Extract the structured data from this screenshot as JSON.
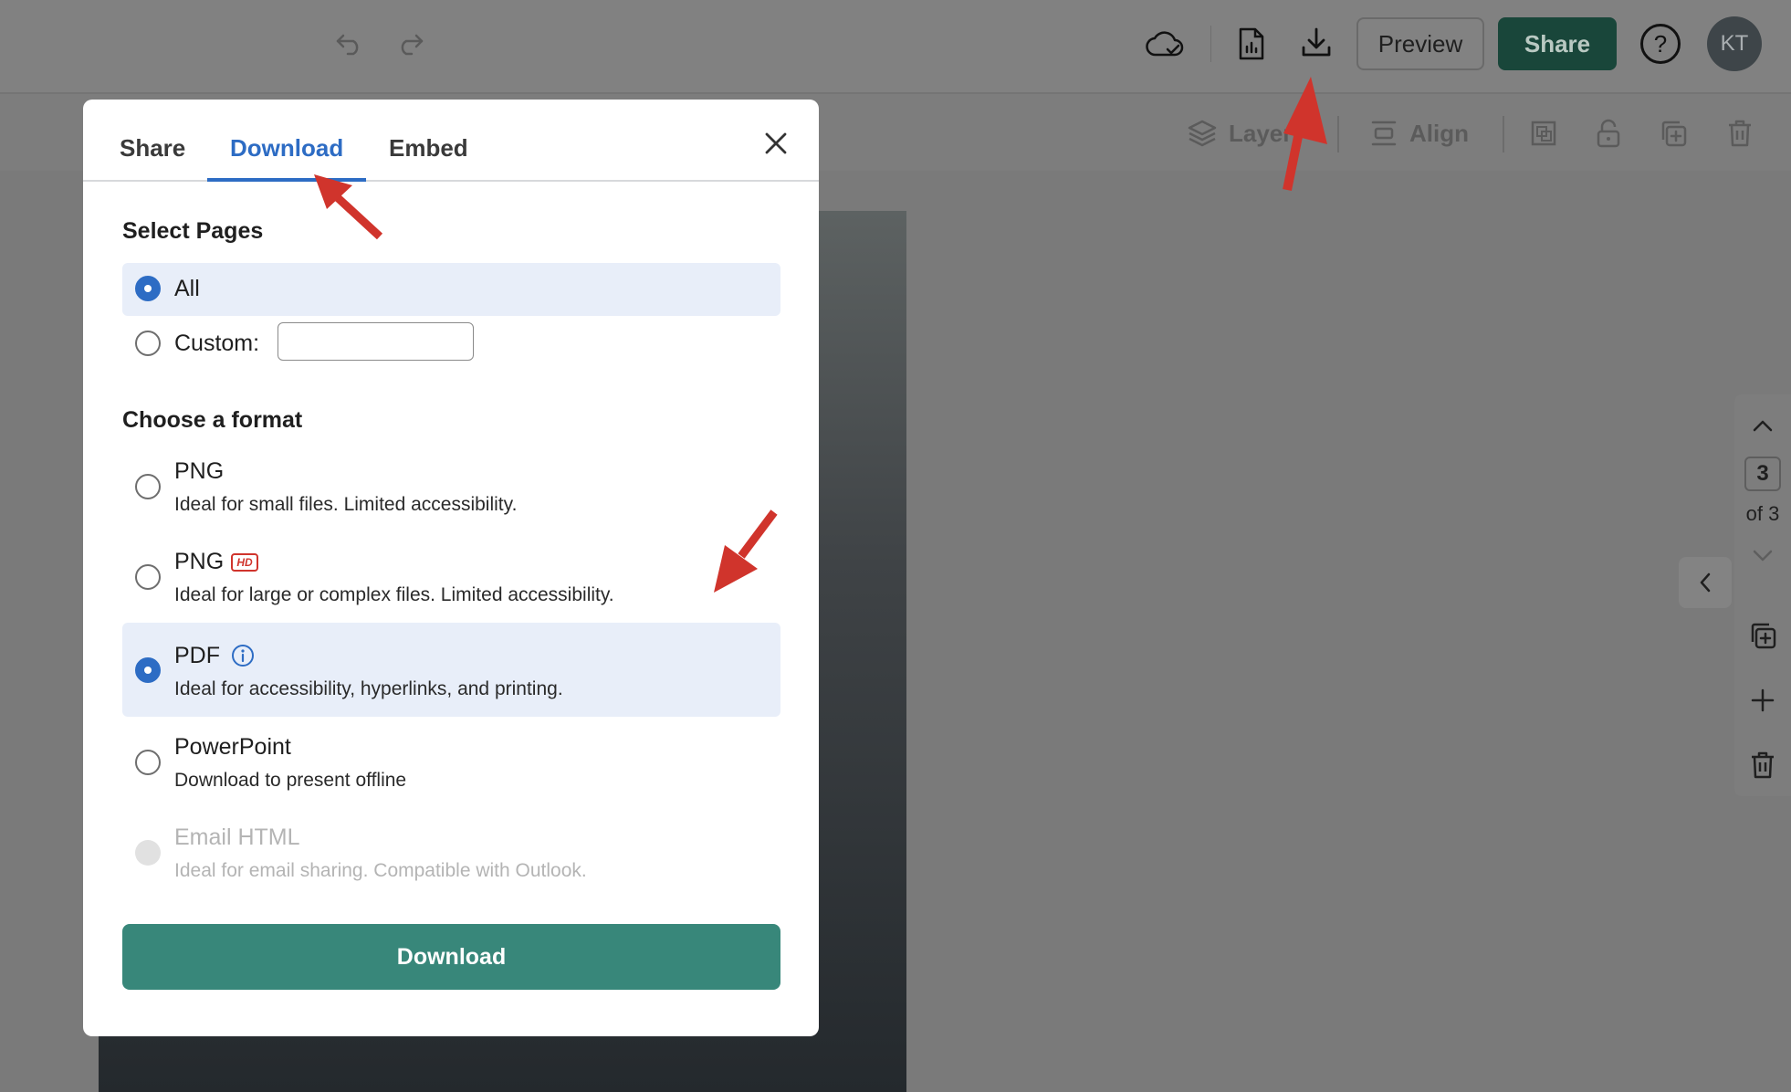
{
  "topbar": {
    "preview_label": "Preview",
    "share_label": "Share",
    "help_label": "?",
    "avatar_initials": "KT"
  },
  "toolbar": {
    "layers_label": "Layer",
    "align_label": "Align"
  },
  "side_panel": {
    "current_page": "3",
    "page_of": "of 3"
  },
  "modal": {
    "tabs": [
      {
        "label": "Share"
      },
      {
        "label": "Download"
      },
      {
        "label": "Embed"
      }
    ],
    "active_tab": "Download",
    "select_pages_title": "Select Pages",
    "pages_all_label": "All",
    "pages_custom_label": "Custom:",
    "custom_value": "",
    "choose_format_title": "Choose a format",
    "formats": [
      {
        "label": "PNG",
        "desc": "Ideal for small files. Limited accessibility.",
        "selected": false,
        "disabled": false
      },
      {
        "label": "PNG",
        "badge": "HD",
        "desc": "Ideal for large or complex files. Limited accessibility.",
        "selected": false,
        "disabled": false
      },
      {
        "label": "PDF",
        "desc": "Ideal for accessibility, hyperlinks, and printing.",
        "selected": true,
        "disabled": false
      },
      {
        "label": "PowerPoint",
        "desc": "Download to present offline",
        "selected": false,
        "disabled": false
      },
      {
        "label": "Email HTML",
        "desc": "Ideal for email sharing. Compatible with Outlook.",
        "selected": false,
        "disabled": true
      }
    ],
    "download_label": "Download"
  },
  "colors": {
    "accent_blue": "#2d6cc4",
    "download_green": "#38877a",
    "share_green": "#19463a",
    "annotation_red": "#d0342c"
  }
}
